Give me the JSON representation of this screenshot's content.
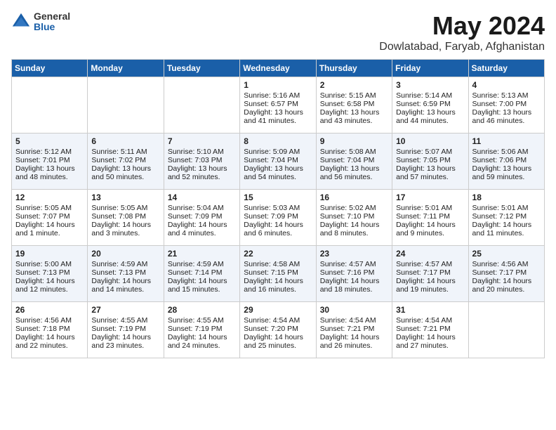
{
  "logo": {
    "general": "General",
    "blue": "Blue"
  },
  "title": "May 2024",
  "subtitle": "Dowlatabad, Faryab, Afghanistan",
  "days_of_week": [
    "Sunday",
    "Monday",
    "Tuesday",
    "Wednesday",
    "Thursday",
    "Friday",
    "Saturday"
  ],
  "weeks": [
    [
      {
        "day": "",
        "info": ""
      },
      {
        "day": "",
        "info": ""
      },
      {
        "day": "",
        "info": ""
      },
      {
        "day": "1",
        "info": "Sunrise: 5:16 AM\nSunset: 6:57 PM\nDaylight: 13 hours\nand 41 minutes."
      },
      {
        "day": "2",
        "info": "Sunrise: 5:15 AM\nSunset: 6:58 PM\nDaylight: 13 hours\nand 43 minutes."
      },
      {
        "day": "3",
        "info": "Sunrise: 5:14 AM\nSunset: 6:59 PM\nDaylight: 13 hours\nand 44 minutes."
      },
      {
        "day": "4",
        "info": "Sunrise: 5:13 AM\nSunset: 7:00 PM\nDaylight: 13 hours\nand 46 minutes."
      }
    ],
    [
      {
        "day": "5",
        "info": "Sunrise: 5:12 AM\nSunset: 7:01 PM\nDaylight: 13 hours\nand 48 minutes."
      },
      {
        "day": "6",
        "info": "Sunrise: 5:11 AM\nSunset: 7:02 PM\nDaylight: 13 hours\nand 50 minutes."
      },
      {
        "day": "7",
        "info": "Sunrise: 5:10 AM\nSunset: 7:03 PM\nDaylight: 13 hours\nand 52 minutes."
      },
      {
        "day": "8",
        "info": "Sunrise: 5:09 AM\nSunset: 7:04 PM\nDaylight: 13 hours\nand 54 minutes."
      },
      {
        "day": "9",
        "info": "Sunrise: 5:08 AM\nSunset: 7:04 PM\nDaylight: 13 hours\nand 56 minutes."
      },
      {
        "day": "10",
        "info": "Sunrise: 5:07 AM\nSunset: 7:05 PM\nDaylight: 13 hours\nand 57 minutes."
      },
      {
        "day": "11",
        "info": "Sunrise: 5:06 AM\nSunset: 7:06 PM\nDaylight: 13 hours\nand 59 minutes."
      }
    ],
    [
      {
        "day": "12",
        "info": "Sunrise: 5:05 AM\nSunset: 7:07 PM\nDaylight: 14 hours\nand 1 minute."
      },
      {
        "day": "13",
        "info": "Sunrise: 5:05 AM\nSunset: 7:08 PM\nDaylight: 14 hours\nand 3 minutes."
      },
      {
        "day": "14",
        "info": "Sunrise: 5:04 AM\nSunset: 7:09 PM\nDaylight: 14 hours\nand 4 minutes."
      },
      {
        "day": "15",
        "info": "Sunrise: 5:03 AM\nSunset: 7:09 PM\nDaylight: 14 hours\nand 6 minutes."
      },
      {
        "day": "16",
        "info": "Sunrise: 5:02 AM\nSunset: 7:10 PM\nDaylight: 14 hours\nand 8 minutes."
      },
      {
        "day": "17",
        "info": "Sunrise: 5:01 AM\nSunset: 7:11 PM\nDaylight: 14 hours\nand 9 minutes."
      },
      {
        "day": "18",
        "info": "Sunrise: 5:01 AM\nSunset: 7:12 PM\nDaylight: 14 hours\nand 11 minutes."
      }
    ],
    [
      {
        "day": "19",
        "info": "Sunrise: 5:00 AM\nSunset: 7:13 PM\nDaylight: 14 hours\nand 12 minutes."
      },
      {
        "day": "20",
        "info": "Sunrise: 4:59 AM\nSunset: 7:13 PM\nDaylight: 14 hours\nand 14 minutes."
      },
      {
        "day": "21",
        "info": "Sunrise: 4:59 AM\nSunset: 7:14 PM\nDaylight: 14 hours\nand 15 minutes."
      },
      {
        "day": "22",
        "info": "Sunrise: 4:58 AM\nSunset: 7:15 PM\nDaylight: 14 hours\nand 16 minutes."
      },
      {
        "day": "23",
        "info": "Sunrise: 4:57 AM\nSunset: 7:16 PM\nDaylight: 14 hours\nand 18 minutes."
      },
      {
        "day": "24",
        "info": "Sunrise: 4:57 AM\nSunset: 7:17 PM\nDaylight: 14 hours\nand 19 minutes."
      },
      {
        "day": "25",
        "info": "Sunrise: 4:56 AM\nSunset: 7:17 PM\nDaylight: 14 hours\nand 20 minutes."
      }
    ],
    [
      {
        "day": "26",
        "info": "Sunrise: 4:56 AM\nSunset: 7:18 PM\nDaylight: 14 hours\nand 22 minutes."
      },
      {
        "day": "27",
        "info": "Sunrise: 4:55 AM\nSunset: 7:19 PM\nDaylight: 14 hours\nand 23 minutes."
      },
      {
        "day": "28",
        "info": "Sunrise: 4:55 AM\nSunset: 7:19 PM\nDaylight: 14 hours\nand 24 minutes."
      },
      {
        "day": "29",
        "info": "Sunrise: 4:54 AM\nSunset: 7:20 PM\nDaylight: 14 hours\nand 25 minutes."
      },
      {
        "day": "30",
        "info": "Sunrise: 4:54 AM\nSunset: 7:21 PM\nDaylight: 14 hours\nand 26 minutes."
      },
      {
        "day": "31",
        "info": "Sunrise: 4:54 AM\nSunset: 7:21 PM\nDaylight: 14 hours\nand 27 minutes."
      },
      {
        "day": "",
        "info": ""
      }
    ]
  ]
}
